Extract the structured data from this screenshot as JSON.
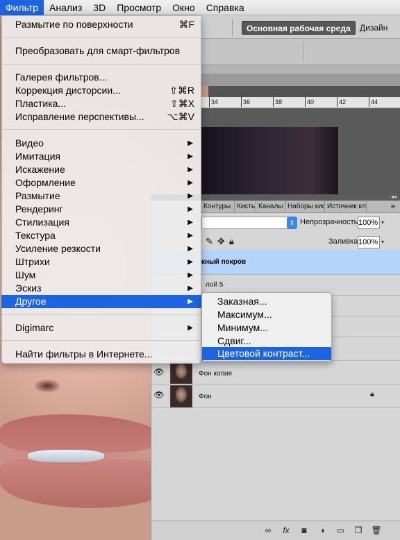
{
  "menubar": {
    "items": [
      "Фильтр",
      "Анализ",
      "3D",
      "Просмотр",
      "Окно",
      "Справка"
    ],
    "active": "Фильтр"
  },
  "options_bar": {
    "workspace_button": "Основная рабочая среда",
    "workspace_design": "Дизайн"
  },
  "ruler": {
    "ticks": [
      "34",
      "36",
      "38",
      "40",
      "42",
      "44"
    ]
  },
  "filter_menu": {
    "last_filter": {
      "label": "Размытие по поверхности",
      "shortcut": "⌘F"
    },
    "smart": "Преобразовать для смарт-фильтров",
    "group1": [
      {
        "label": "Галерея фильтров...",
        "shortcut": ""
      },
      {
        "label": "Коррекция дисторсии...",
        "shortcut": "⇧⌘R"
      },
      {
        "label": "Пластика...",
        "shortcut": "⇧⌘X"
      },
      {
        "label": "Исправление перспективы...",
        "shortcut": "⌥⌘V"
      }
    ],
    "submenus": [
      "Видео",
      "Имитация",
      "Искажение",
      "Оформление",
      "Размытие",
      "Рендеринг",
      "Стилизация",
      "Текстура",
      "Усиление резкости",
      "Штрихи",
      "Шум",
      "Эскиз",
      "Другое"
    ],
    "active_submenu": "Другое",
    "digimarc": "Digimarc",
    "online": "Найти фильтры в Интернете..."
  },
  "other_submenu": {
    "items": [
      "Заказная...",
      "Максимум...",
      "Минимум...",
      "Сдвиг...",
      "Цветовой контраст..."
    ],
    "active": "Цветовой контраст..."
  },
  "layers_panel": {
    "tabs": [
      "Контуры",
      "Кисть",
      "Каналы",
      "Наборы кис",
      "Источник кл"
    ],
    "opacity_label": "Непрозрачность:",
    "opacity_value": "100%",
    "fill_label": "Заливка:",
    "fill_value": "100%",
    "layers": [
      {
        "name": "жный покров",
        "selected": true
      },
      {
        "name": "лой 5",
        "selected": false
      },
      {
        "name": "Фон копия",
        "selected": false
      },
      {
        "name": "Фон",
        "selected": false,
        "locked": true
      }
    ]
  },
  "colors": {
    "menu_highlight": "#1d64e3",
    "selected_layer": "#b4d4f9"
  }
}
